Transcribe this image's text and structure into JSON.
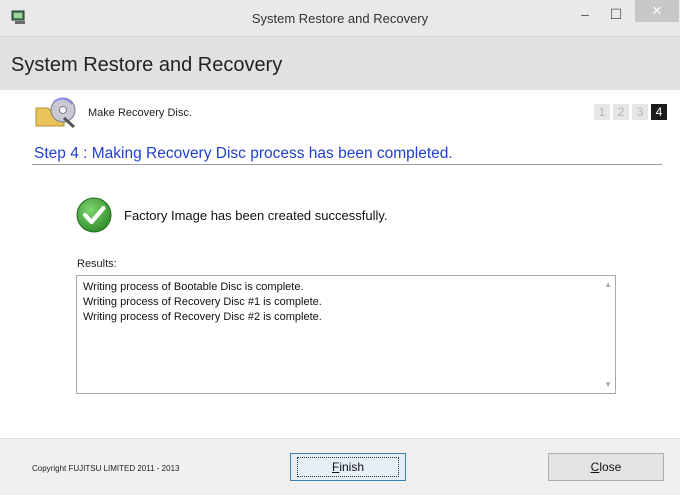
{
  "window": {
    "title": "System Restore and Recovery",
    "minimize_glyph": "–",
    "maximize_glyph": "☐",
    "close_glyph": "✕"
  },
  "header": {
    "title": "System Restore and Recovery"
  },
  "task": {
    "label": "Make Recovery Disc.",
    "icon": "disc-icon"
  },
  "steps": [
    "1",
    "2",
    "3",
    "4"
  ],
  "active_step": "4",
  "step_title": "Step 4 : Making Recovery Disc process has been completed.",
  "success": {
    "message": "Factory Image has been created successfully.",
    "icon": "check-icon",
    "color": "#3fa83a"
  },
  "results": {
    "label": "Results:",
    "lines": [
      "Writing process of Bootable Disc is complete.",
      "Writing process of Recovery Disc #1 is complete.",
      "Writing process of Recovery Disc #2 is complete."
    ]
  },
  "footer": {
    "copyright": "Copyright FUJITSU LIMITED 2011 - 2013",
    "finish_first": "F",
    "finish_rest": "inish",
    "close_first": "C",
    "close_rest": "lose"
  },
  "colors": {
    "step_title": "#1f3fcf",
    "active_step_bg": "#1b1b1b"
  }
}
